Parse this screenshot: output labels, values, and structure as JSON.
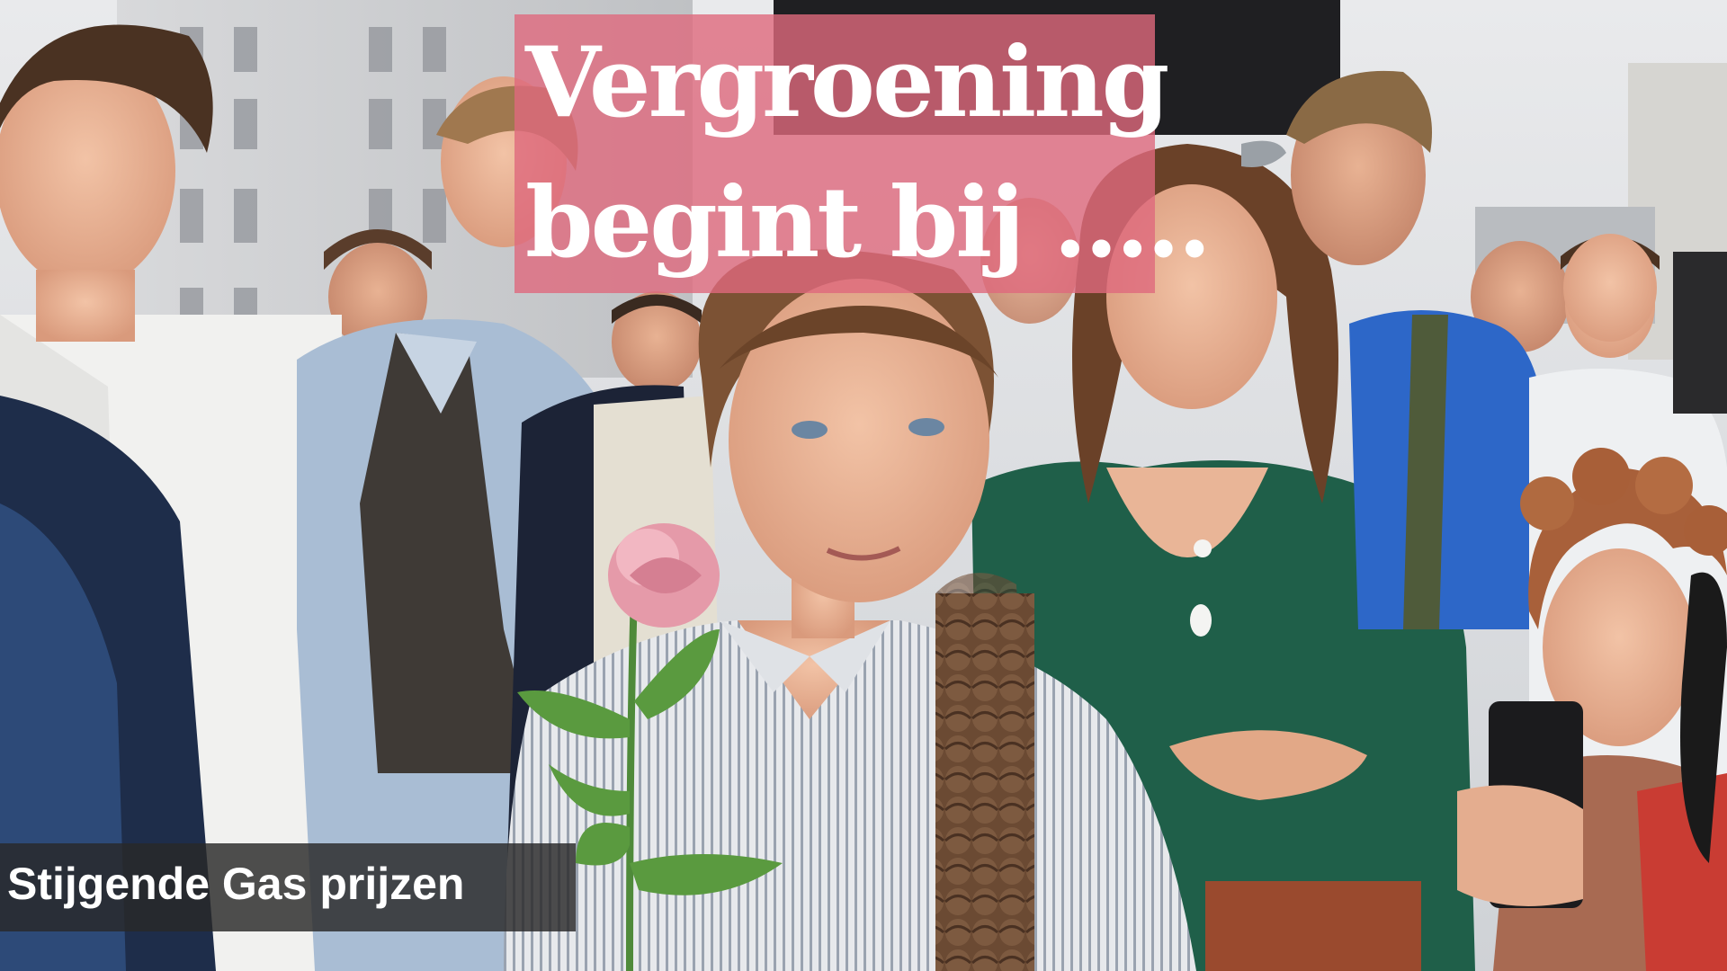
{
  "headline": {
    "line1": "Vergroening",
    "line2": "begint bij .....",
    "box_color": "#de697d"
  },
  "caption": {
    "text": "Stijgende Gas prijzen",
    "box_color": "#282828"
  },
  "photo": {
    "subject": "smiling girl with long braid holding a pink rose, crowd of people behind"
  }
}
